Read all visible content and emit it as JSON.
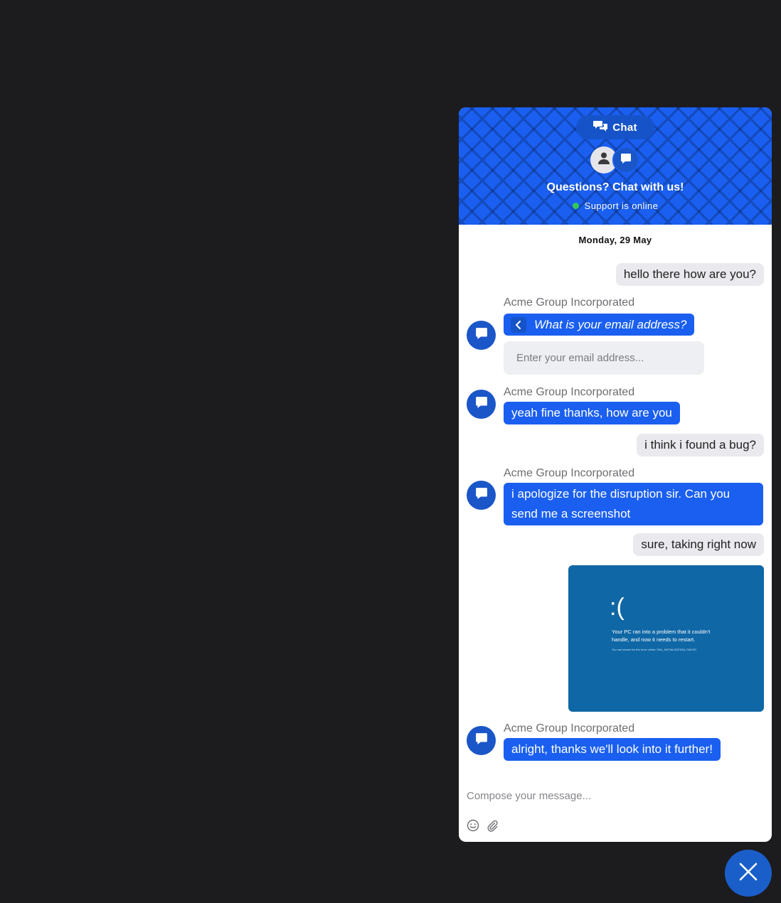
{
  "header": {
    "tab_label": "Chat",
    "title": "Questions? Chat with us!",
    "status": "Support is online"
  },
  "date_label": "Monday, 29 May",
  "sender_name": "Acme Group Incorporated",
  "messages": {
    "m1": "hello there how are you?",
    "m2_question": "What is your email address?",
    "m2_placeholder": "Enter your email address...",
    "m3": "yeah fine thanks, how are you",
    "m4": "i think i found a bug?",
    "m5": "i apologize for the disruption sir. Can you send me a screenshot",
    "m6": "sure, taking right now",
    "m8": "alright, thanks we'll look into it further!"
  },
  "screenshot": {
    "face": ":(",
    "text": "Your PC ran into a problem that it couldn't handle, and now it needs to restart.",
    "small": "You can search for the error online: FAIL_INITIALIZATION_FAILED"
  },
  "composer": {
    "placeholder": "Compose your message..."
  },
  "icons": {
    "tab": "chat-bubbles-icon",
    "user": "user-icon",
    "bot": "chat-bubble-icon",
    "back": "chevron-left-icon",
    "emoji": "emoji-icon",
    "attach": "paperclip-icon",
    "close": "close-icon"
  },
  "colors": {
    "brand": "#1a5ff0",
    "online": "#34c759",
    "page_bg": "#1c1c1e"
  }
}
